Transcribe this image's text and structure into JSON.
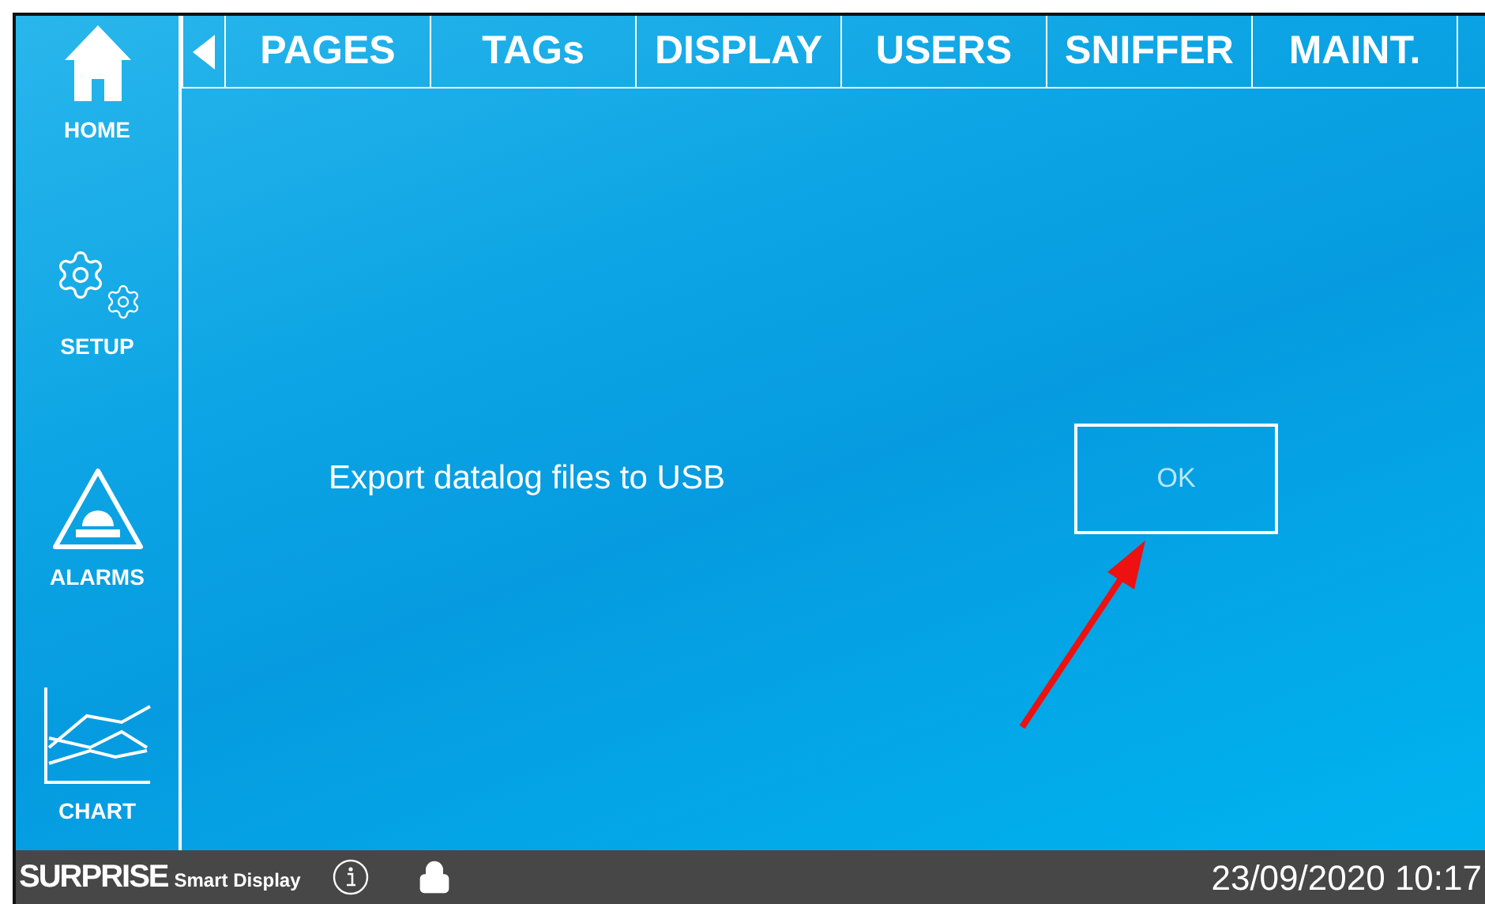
{
  "sidebar": {
    "items": [
      {
        "kind": "home",
        "label": "HOME"
      },
      {
        "kind": "setup",
        "label": "SETUP"
      },
      {
        "kind": "alarms",
        "label": "ALARMS"
      },
      {
        "kind": "chart",
        "label": "CHART"
      }
    ]
  },
  "tabs": [
    "PAGES",
    "TAGs",
    "DISPLAY",
    "USERS",
    "SNIFFER",
    "MAINT."
  ],
  "content": {
    "label": "Export datalog files to USB",
    "button": "OK"
  },
  "status_bar": {
    "brand": "SURPRISE",
    "product": "Smart Display",
    "datetime": "23/09/2020 10:17"
  }
}
